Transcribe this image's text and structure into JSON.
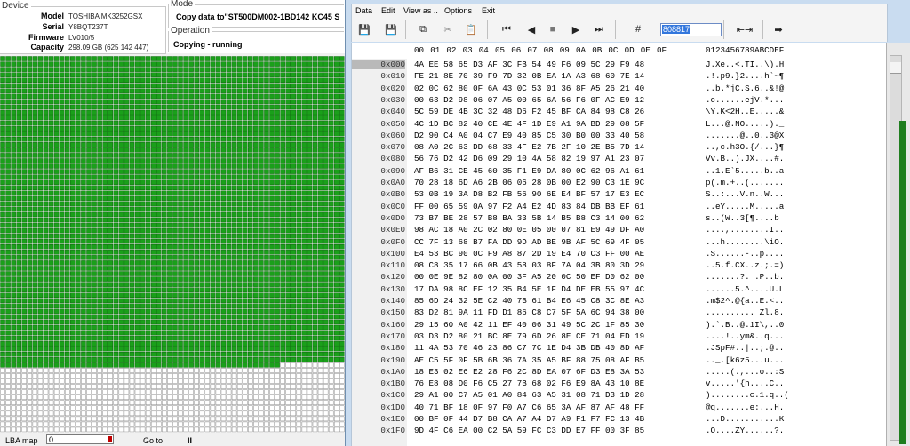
{
  "device": {
    "legend": "Device",
    "model_label": "Model",
    "model": "TOSHIBA MK3252GSX",
    "serial_label": "Serial",
    "serial": "Y8BQT237T",
    "firmware_label": "Firmware",
    "firmware": "LV010/5",
    "capacity_label": "Capacity",
    "capacity": "298.09 GB (625 142 447)"
  },
  "mode": {
    "legend": "Mode",
    "text": "Copy data to\"ST500DM002-1BD142 KC45 S",
    "operation_legend": "Operation",
    "operation": "Copying - running"
  },
  "lba_map": {
    "filled_fraction": 0.826,
    "fill_color": "#1aa01a",
    "empty_color": "#ffffff"
  },
  "status": {
    "lba_label": "LBA map",
    "lba_value": "0",
    "goto_label": "Go to",
    "pause_symbol": "II"
  },
  "hex": {
    "menu": [
      "Data",
      "Edit",
      "View as ..",
      "Options",
      "Exit"
    ],
    "offset_value": "808817",
    "col_heads": [
      "00",
      "01",
      "02",
      "03",
      "04",
      "05",
      "06",
      "07",
      "08",
      "09",
      "0A",
      "0B",
      "0C",
      "0D",
      "0E",
      "0F"
    ],
    "ascii_head": "0123456789ABCDEF",
    "rows": [
      {
        "off": "0x000",
        "bytes": "4A EE 58 65 D3 AF 3C FB 54 49 F6 09 5C 29 F9 48",
        "ascii": "J.Xe..<.TI..\\).H"
      },
      {
        "off": "0x010",
        "bytes": "FE 21 8E 70 39 F9 7D 32 0B EA 1A A3 68 60 7E 14",
        "ascii": ".!.p9.}2....h`~¶"
      },
      {
        "off": "0x020",
        "bytes": "02 0C 62 80 0F 6A 43 0C 53 01 36 8F A5 26 21 40",
        "ascii": "..b.*jC.S.6..&!@"
      },
      {
        "off": "0x030",
        "bytes": "00 63 D2 98 06 07 A5 00 65 6A 56 F6 0F AC E9 12",
        "ascii": ".c......ejV.*..."
      },
      {
        "off": "0x040",
        "bytes": "5C 59 DE 4B 3C 32 48 D6 F2 45 BF CA 84 98 C8 26",
        "ascii": "\\Y.K<2H..E.....&"
      },
      {
        "off": "0x050",
        "bytes": "4C 1D BC 82 40 CE 4E 4F 1D E9 A1 9A BD 29 08 5F",
        "ascii": "L...@.NO.....)._"
      },
      {
        "off": "0x060",
        "bytes": "D2 90 C4 A0 04 C7 E9 40 85 C5 30 B0 00 33 40 58",
        "ascii": ".......@..0..3@X"
      },
      {
        "off": "0x070",
        "bytes": "08 A0 2C 63 DD 68 33 4F E2 7B 2F 10 2E B5 7D 14",
        "ascii": "..,c.h3O.{/...}¶"
      },
      {
        "off": "0x080",
        "bytes": "56 76 D2 42 D6 09 29 10 4A 58 82 19 97 A1 23 07",
        "ascii": "Vv.B..).JX....#."
      },
      {
        "off": "0x090",
        "bytes": "AF B6 31 CE 45 60 35 F1 E9 DA 80 0C 62 96 A1 61",
        "ascii": "..1.E`5.....b..a"
      },
      {
        "off": "0x0A0",
        "bytes": "70 28 18 6D A6 2B 06 06 28 0B 00 E2 90 C3 1E 9C",
        "ascii": "p(.m.+..(......."
      },
      {
        "off": "0x0B0",
        "bytes": "53 0B 19 3A D8 B2 FB 56 90 6E E4 BF 57 17 E3 EC",
        "ascii": "S..:...V.n..W..."
      },
      {
        "off": "0x0C0",
        "bytes": "FF 00 65 59 0A 97 F2 A4 E2 4D 83 84 DB BB EF 61",
        "ascii": "..eY.....M.....a"
      },
      {
        "off": "0x0D0",
        "bytes": "73 B7 BE 28 57 B8 BA 33 5B 14 B5 B8 C3 14 00 62",
        "ascii": "s..(W..3[¶....b"
      },
      {
        "off": "0x0E0",
        "bytes": "98 AC 18 A0 2C 02 80 0E 05 00 07 81 E9 49 DF A0",
        "ascii": "....,........I.."
      },
      {
        "off": "0x0F0",
        "bytes": "CC 7F 13 68 B7 FA DD 9D AD BE 9B AF 5C 69 4F 05",
        "ascii": "...h........\\iO."
      },
      {
        "off": "0x100",
        "bytes": "E4 53 BC 90 0C F9 A8 87 2D 19 E4 70 C3 FF 00 AE",
        "ascii": ".S......-..p...."
      },
      {
        "off": "0x110",
        "bytes": "08 C8 35 17 66 0B 43 58 03 8F 7A 04 3B 80 3D 29",
        "ascii": "..5.f.CX..z.;.=)"
      },
      {
        "off": "0x120",
        "bytes": "00 0E 9E 82 80 0A 00 3F A5 20 0C 50 EF D0 62 00",
        "ascii": ".......?. .P..b."
      },
      {
        "off": "0x130",
        "bytes": "17 DA 98 8C EF 12 35 B4 5E 1F D4 DE EB 55 97 4C",
        "ascii": "......5.^....U.L"
      },
      {
        "off": "0x140",
        "bytes": "85 6D 24 32 5E C2 40 7B 61 B4 E6 45 C8 3C 8E A3",
        "ascii": ".m$2^.@{a..E.<.."
      },
      {
        "off": "0x150",
        "bytes": "83 D2 81 9A 11 FD D1 86 C8 C7 5F 5A 6C 94 38 00",
        "ascii": ".........._Zl.8."
      },
      {
        "off": "0x160",
        "bytes": "29 15 60 A0 42 11 EF 40 06 31 49 5C 2C 1F 85 30",
        "ascii": ").`.B..@.1I\\,..0"
      },
      {
        "off": "0x170",
        "bytes": "03 D3 D2 80 21 BC 8E 79 6D 26 8E CE 71 04 ED 19",
        "ascii": "....!..ym&..q..."
      },
      {
        "off": "0x180",
        "bytes": "11 4A 53 70 46 23 86 C7 7C 1E D4 3B DB 40 8D AF",
        "ascii": ".JSpF#..|..;.@.."
      },
      {
        "off": "0x190",
        "bytes": "AE C5 5F 0F 5B 6B 36 7A 35 A5 BF 88 75 08 AF B5",
        "ascii": ".._.[k6z5...u..."
      },
      {
        "off": "0x1A0",
        "bytes": "18 E3 02 E6 E2 28 F6 2C 8D EA 07 6F D3 E8 3A 53",
        "ascii": ".....(.,...o..:S"
      },
      {
        "off": "0x1B0",
        "bytes": "76 E8 08 D0 F6 C5 27 7B 68 02 F6 E9 8A 43 10 8E",
        "ascii": "v.....'{h....C.."
      },
      {
        "off": "0x1C0",
        "bytes": "29 A1 00 C7 A5 01 A0 84 63 A5 31 08 71 D3 1D 28",
        "ascii": ")........c.1.q..("
      },
      {
        "off": "0x1D0",
        "bytes": "40 71 BF 18 0F 97 F0 A7 C6 65 3A AF 87 AF 48 FF",
        "ascii": "@q.......e:...H."
      },
      {
        "off": "0x1E0",
        "bytes": "00 BF 0F 44 D7 B8 CA A7 A4 D7 A9 F1 F7 FC 13 4B",
        "ascii": "...D...........K"
      },
      {
        "off": "0x1F0",
        "bytes": "9D 4F C6 EA 00 C2 5A 59 FC C3 DD E7 FF 00 3F 85",
        "ascii": ".O....ZY......?."
      }
    ]
  }
}
